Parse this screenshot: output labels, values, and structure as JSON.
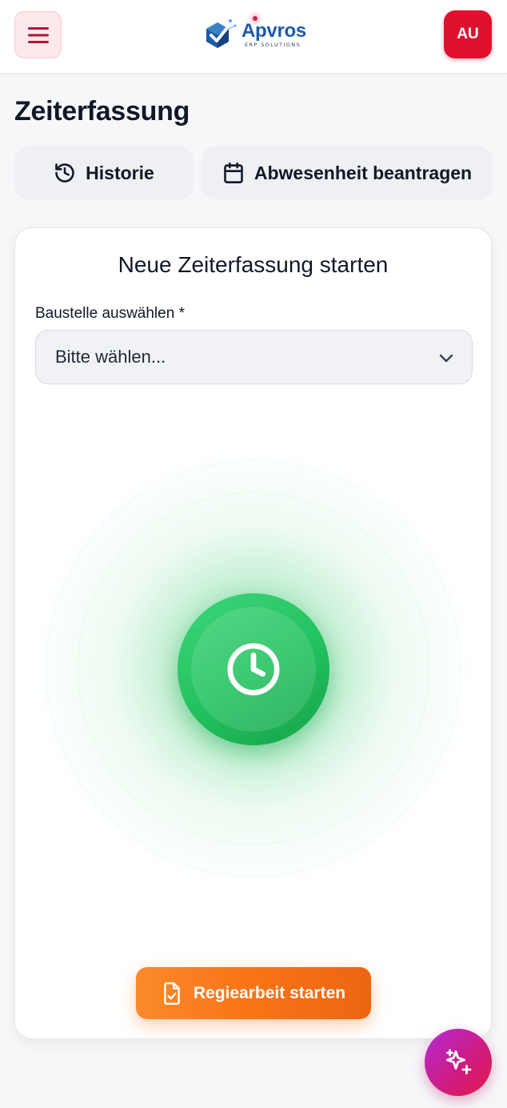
{
  "header": {
    "brand_name": "Apvros",
    "brand_sub": "ERP SOLUTIONS",
    "avatar_initials": "AU"
  },
  "page": {
    "title": "Zeiterfassung"
  },
  "actions": {
    "history_label": "Historie",
    "absence_label": "Abwesenheit beantragen"
  },
  "card": {
    "title": "Neue Zeiterfassung starten",
    "site_label": "Baustelle auswählen *",
    "site_select_value": "Bitte wählen...",
    "regie_button_label": "Regiearbeit starten"
  },
  "colors": {
    "accent_red": "#e0102f",
    "clock_green": "#22c05e",
    "regie_orange": "#f97316",
    "fab_purple": "#b32bd6"
  },
  "icons": {
    "menu": "hamburger-icon",
    "history": "history-icon",
    "absence": "calendar-icon",
    "select": "chevron-down-icon",
    "clock": "clock-icon",
    "regie": "file-check-icon",
    "fab": "sparkles-icon"
  }
}
